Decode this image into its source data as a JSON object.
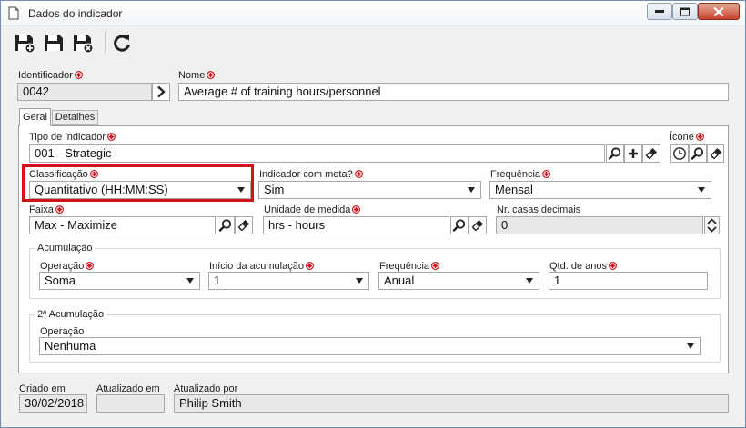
{
  "window": {
    "title": "Dados do indicador",
    "controls": [
      "minimize-icon",
      "maximize-icon",
      "close-icon"
    ]
  },
  "toolbar": {
    "buttons": [
      "save-new-icon",
      "save-icon",
      "save-close-icon",
      "refresh-icon"
    ]
  },
  "header": {
    "identificador_label": "Identificador",
    "identificador_value": "0042",
    "nome_label": "Nome",
    "nome_value": "Average # of training hours/personnel"
  },
  "tabs": [
    {
      "label": "Geral",
      "active": true
    },
    {
      "label": "Detalhes",
      "active": false
    }
  ],
  "geral": {
    "tipo_label": "Tipo de indicador",
    "tipo_value": "001 - Strategic",
    "icone_label": "Ícone",
    "classificacao_label": "Classificação",
    "classificacao_value": "Quantitativo (HH:MM:SS)",
    "meta_label": "Indicador com meta?",
    "meta_value": "Sim",
    "frequencia_label": "Frequência",
    "frequencia_value": "Mensal",
    "faixa_label": "Faixa",
    "faixa_value": "Max - Maximize",
    "unidade_label": "Unidade de medida",
    "unidade_value": "hrs - hours",
    "casas_label": "Nr. casas decimais",
    "casas_value": "0"
  },
  "acumulacao": {
    "legend": "Acumulação",
    "operacao_label": "Operação",
    "operacao_value": "Soma",
    "inicio_label": "Início da acumulação",
    "inicio_value": "1",
    "frequencia_label": "Frequência",
    "frequencia_value": "Anual",
    "qtd_label": "Qtd. de anos",
    "qtd_value": "1"
  },
  "acumulacao2": {
    "legend": "2ª Acumulação",
    "operacao_label": "Operação",
    "operacao_value": "Nenhuma"
  },
  "footer": {
    "criado_label": "Criado em",
    "criado_value": "30/02/2018",
    "atualizado_em_label": "Atualizado em",
    "atualizado_em_value": "",
    "atualizado_por_label": "Atualizado por",
    "atualizado_por_value": "Philip Smith"
  },
  "colors": {
    "required": "#d0121b",
    "highlight": "#d0121b",
    "window_border": "#6e8fb3"
  }
}
